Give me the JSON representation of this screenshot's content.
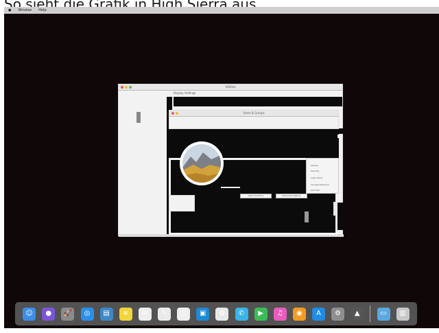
{
  "caption": "So sieht die Grafik in High Sierra aus",
  "menubar": {
    "items": [
      "Window",
      "Help"
    ]
  },
  "back_window": {
    "title": "Utilities",
    "subtitle": "Display Settings"
  },
  "front_window": {
    "title": "Users & Groups"
  },
  "side_menu": {
    "items": [
      "Startup",
      "Security",
      "Login Items",
      "Change Password",
      "Add User"
    ]
  },
  "buttons": {
    "open": "Open Directory",
    "advanced": "Advanced Options"
  },
  "dock": {
    "icons": [
      {
        "name": "finder-icon",
        "glyph": "☺",
        "color": "#3a8ee6"
      },
      {
        "name": "siri-icon",
        "glyph": "●",
        "color": "#7a56d6"
      },
      {
        "name": "launchpad-icon",
        "glyph": "🚀",
        "color": "#8b8b8b"
      },
      {
        "name": "safari-icon",
        "glyph": "◎",
        "color": "#2a8fe9"
      },
      {
        "name": "preview-icon",
        "glyph": "▤",
        "color": "#3e88c8"
      },
      {
        "name": "notes-icon",
        "glyph": "≡",
        "color": "#f1d53d"
      },
      {
        "name": "mail-icon",
        "glyph": "✉",
        "color": "#ededed"
      },
      {
        "name": "textedit-icon",
        "glyph": "✎",
        "color": "#eaeaea"
      },
      {
        "name": "pages-icon",
        "glyph": "▯",
        "color": "#efefef"
      },
      {
        "name": "photos-folder-icon",
        "glyph": "▣",
        "color": "#1e89d4"
      },
      {
        "name": "photos-icon",
        "glyph": "✿",
        "color": "#e8e8e8"
      },
      {
        "name": "messages-icon",
        "glyph": "✆",
        "color": "#39b4e9"
      },
      {
        "name": "facetime-icon",
        "glyph": "▶",
        "color": "#3bbc55"
      },
      {
        "name": "itunes-icon",
        "glyph": "♫",
        "color": "#e85dbd"
      },
      {
        "name": "ibooks-icon",
        "glyph": "◉",
        "color": "#f39c24"
      },
      {
        "name": "app-store-icon",
        "glyph": "A",
        "color": "#1f8ce6"
      },
      {
        "name": "system-preferences-icon",
        "glyph": "⚙",
        "color": "#8f8f8f"
      },
      {
        "name": "tv-icon",
        "glyph": "▲",
        "color": "#555555"
      },
      {
        "name": "folder-icon",
        "glyph": "▭",
        "color": "#5aa8e0"
      },
      {
        "name": "trash-icon",
        "glyph": "▥",
        "color": "#c8c8c8"
      }
    ]
  }
}
